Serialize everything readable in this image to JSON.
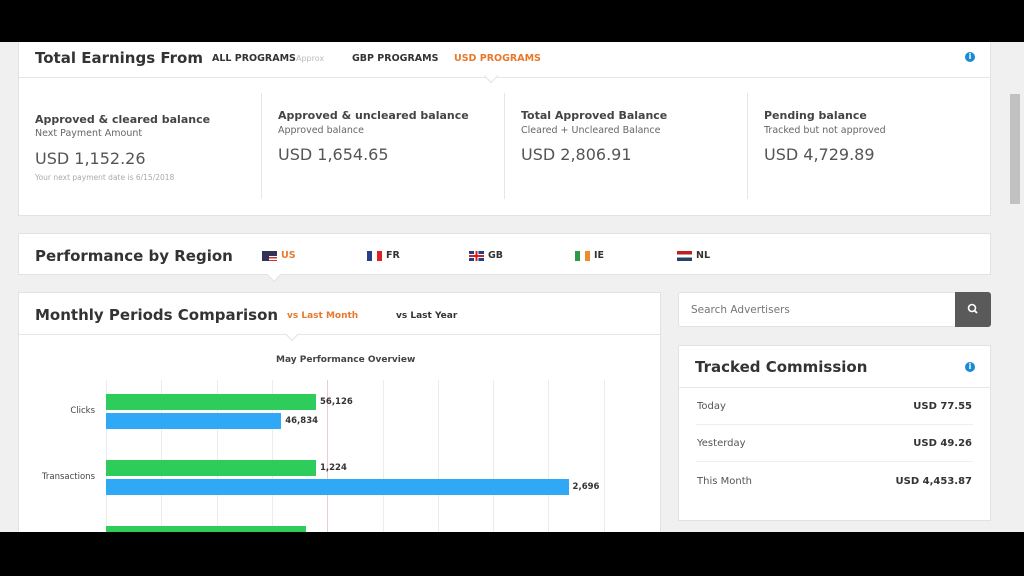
{
  "earnings": {
    "title": "Total Earnings From",
    "tabs": [
      {
        "label": "ALL PROGRAMS",
        "note": "Approx"
      },
      {
        "label": "GBP PROGRAMS"
      },
      {
        "label": "USD PROGRAMS",
        "active": true
      }
    ],
    "balances": [
      {
        "title": "Approved & cleared balance",
        "sub": "Next Payment Amount",
        "amount": "USD 1,152.26",
        "note": "Your next payment date is 6/15/2018"
      },
      {
        "title": "Approved & uncleared balance",
        "sub": "Approved balance",
        "amount": "USD 1,654.65"
      },
      {
        "title": "Total Approved Balance",
        "sub": "Cleared + Uncleared Balance",
        "amount": "USD 2,806.91"
      },
      {
        "title": "Pending balance",
        "sub": "Tracked but not approved",
        "amount": "USD 4,729.89"
      }
    ],
    "info_icon": "info-icon"
  },
  "region": {
    "title": "Performance by Region",
    "items": [
      {
        "code": "US",
        "active": true
      },
      {
        "code": "FR"
      },
      {
        "code": "GB"
      },
      {
        "code": "IE"
      },
      {
        "code": "NL"
      }
    ]
  },
  "monthly": {
    "title": "Monthly Periods Comparison",
    "tabs": [
      {
        "label": "vs Last Month",
        "active": true
      },
      {
        "label": "vs Last Year"
      }
    ]
  },
  "chart_data": {
    "type": "bar",
    "orientation": "horizontal",
    "title": "May Performance Overview",
    "categories": [
      "Clicks",
      "Transactions"
    ],
    "series": [
      {
        "values": [
          56126,
          1224
        ],
        "labels": [
          "56,126",
          "1,224"
        ],
        "color": "#2ecc5a"
      },
      {
        "values": [
          46834,
          2696
        ],
        "labels": [
          "46,834",
          "2,696"
        ],
        "color": "#2fa8f5"
      }
    ],
    "grid": true
  },
  "search": {
    "placeholder": "Search Advertisers"
  },
  "tracked": {
    "title": "Tracked Commission",
    "rows": [
      {
        "label": "Today",
        "value": "USD 77.55"
      },
      {
        "label": "Yesterday",
        "value": "USD 49.26"
      },
      {
        "label": "This Month",
        "value": "USD 4,453.87"
      }
    ]
  },
  "colors": {
    "accent": "#e8792b",
    "info": "#1a8ad4",
    "green": "#2ecc5a",
    "blue": "#2fa8f5"
  }
}
